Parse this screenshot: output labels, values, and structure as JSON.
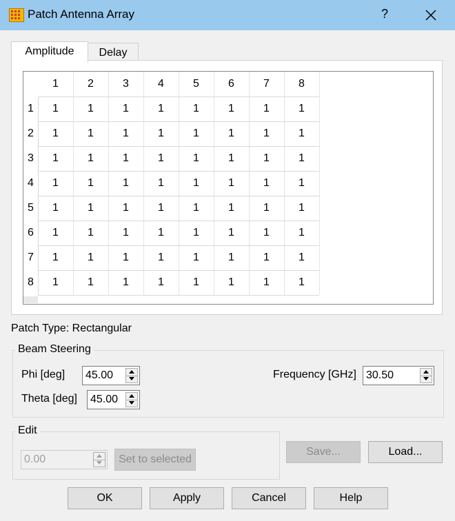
{
  "window": {
    "title": "Patch Antenna Array",
    "help_glyph": "?",
    "title_bar_color": "#9ac9ee"
  },
  "tabs": [
    {
      "label": "Amplitude",
      "active": true
    },
    {
      "label": "Delay",
      "active": false
    }
  ],
  "grid": {
    "column_headers": [
      "1",
      "2",
      "3",
      "4",
      "5",
      "6",
      "7",
      "8"
    ],
    "row_headers": [
      "1",
      "2",
      "3",
      "4",
      "5",
      "6",
      "7",
      "8"
    ],
    "rows": [
      [
        "1",
        "1",
        "1",
        "1",
        "1",
        "1",
        "1",
        "1"
      ],
      [
        "1",
        "1",
        "1",
        "1",
        "1",
        "1",
        "1",
        "1"
      ],
      [
        "1",
        "1",
        "1",
        "1",
        "1",
        "1",
        "1",
        "1"
      ],
      [
        "1",
        "1",
        "1",
        "1",
        "1",
        "1",
        "1",
        "1"
      ],
      [
        "1",
        "1",
        "1",
        "1",
        "1",
        "1",
        "1",
        "1"
      ],
      [
        "1",
        "1",
        "1",
        "1",
        "1",
        "1",
        "1",
        "1"
      ],
      [
        "1",
        "1",
        "1",
        "1",
        "1",
        "1",
        "1",
        "1"
      ],
      [
        "1",
        "1",
        "1",
        "1",
        "1",
        "1",
        "1",
        "1"
      ]
    ]
  },
  "patch_type": "Patch Type: Rectangular",
  "beam_steering": {
    "title": "Beam Steering",
    "phi_label": "Phi [deg]",
    "phi_value": "45.00",
    "theta_label": "Theta [deg]",
    "theta_value": "45.00",
    "frequency_label": "Frequency [GHz]",
    "frequency_value": "30.50"
  },
  "edit": {
    "title": "Edit",
    "value": "0.00",
    "set_label": "Set to selected"
  },
  "buttons": {
    "save": "Save...",
    "load": "Load...",
    "ok": "OK",
    "apply": "Apply",
    "cancel": "Cancel",
    "help": "Help"
  }
}
